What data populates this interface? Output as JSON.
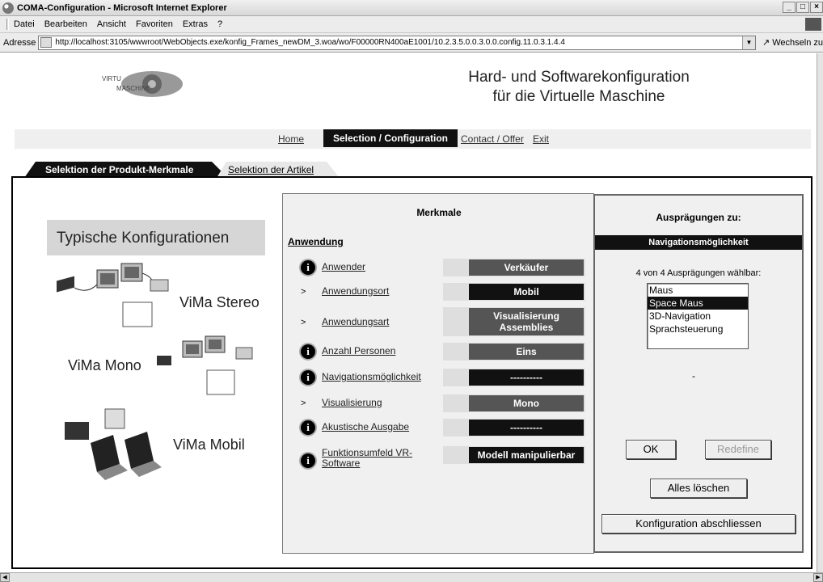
{
  "window": {
    "title": "COMA-Configuration - Microsoft Internet Explorer",
    "buttons": [
      "_",
      "□",
      "×"
    ]
  },
  "menubar": {
    "items": [
      "Datei",
      "Bearbeiten",
      "Ansicht",
      "Favoriten",
      "Extras",
      "?"
    ]
  },
  "addressbar": {
    "label": "Adresse",
    "url": "http://localhost:3105/wwwroot/WebObjects.exe/konfig_Frames_newDM_3.woa/wo/F00000RN400aE1001/10.2.3.5.0.0.3.0.0.config.11.0.3.1.4.4",
    "go_label": "Wechseln zu"
  },
  "header": {
    "logo_text": "VIRTUELLE MASCHINE",
    "headline_line1": "Hard- und Softwarekonfiguration",
    "headline_line2": "für die Virtuelle Maschine"
  },
  "nav": {
    "home": "Home",
    "selection": "Selection / Configuration",
    "contact": "Contact / Offer",
    "exit": "Exit"
  },
  "tabs": {
    "active": "Selektion der Produkt-Merkmale",
    "inactive": "Selektion der Artikel"
  },
  "typical": {
    "heading": "Typische Konfigurationen",
    "stereo": "ViMa Stereo",
    "mono": "ViMa Mono",
    "mobil": "ViMa Mobil"
  },
  "merkmale": {
    "title": "Merkmale",
    "group": "Anwendung",
    "rows": [
      {
        "label": "Anwender",
        "value": "Verkäufer"
      },
      {
        "label": "Anwendungsort",
        "value": "Mobil"
      },
      {
        "label": "Anwendungsart",
        "value": "Visualisierung Assemblies"
      },
      {
        "label": "Anzahl Personen",
        "value": "Eins"
      },
      {
        "label": "Navigationsmöglichkeit",
        "value": "----------"
      },
      {
        "label": "Visualisierung",
        "value": "Mono"
      },
      {
        "label": "Akustische Ausgabe",
        "value": "----------"
      },
      {
        "label": "Funktionsumfeld VR-Software",
        "value": "Modell manipulierbar"
      }
    ],
    "info_glyph": "i",
    "arrow_glyph": ">"
  },
  "auspraegungen": {
    "title": "Ausprägungen zu:",
    "feature": "Navigationsmöglichkeit",
    "count_text": "4 von 4 Ausprägungen wählbar:",
    "options": [
      "Maus",
      "Space Maus",
      "3D-Navigation",
      "Sprachsteuerung"
    ],
    "selected_index": 1,
    "dot": "-",
    "ok": "OK",
    "redefine": "Redefine",
    "clear": "Alles löschen",
    "finish": "Konfiguration abschliessen"
  },
  "colors": {
    "dark": "#111111",
    "grey_value": "#555555",
    "panel": "#f0f0f0"
  }
}
